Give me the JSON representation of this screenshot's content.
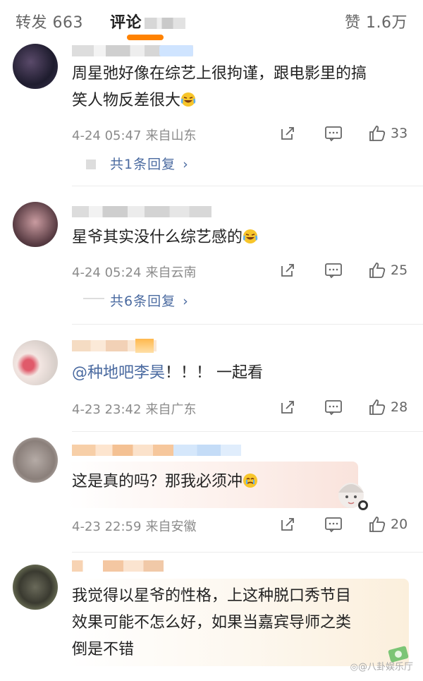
{
  "tabs": {
    "repost_label": "转发 663",
    "comments_label": "评论",
    "likes_label": "赞 1.6万"
  },
  "comments": [
    {
      "content_lines": [
        "周星弛好像在综艺上很拘谨，跟电影里的搞",
        "笑人物反差很大"
      ],
      "time": "4-24 05:47",
      "location": "来自山东",
      "likes": "33",
      "replies": "共1条回复"
    },
    {
      "content_lines": [
        "星爷其实没什么综艺感的"
      ],
      "time": "4-24 05:24",
      "location": "来自云南",
      "likes": "25",
      "replies": "共6条回复"
    },
    {
      "content_mention": "@种地吧李昊",
      "content_rest": "！！！ 一起看",
      "time": "4-23 23:42",
      "location": "来自广东",
      "likes": "28"
    },
    {
      "content_lines": [
        "这是真的吗？那我必须冲"
      ],
      "time": "4-23 22:59",
      "location": "来自安徽",
      "likes": "20"
    },
    {
      "content_lines": [
        "我觉得以星爷的性格，上这种脱口秀节目",
        "效果可能不怎么好，如果当嘉宾导师之类",
        "倒是不错"
      ]
    }
  ],
  "watermark": "八卦娱乐厅",
  "icons": {
    "share": "share-icon",
    "comment": "comment-icon",
    "like": "like-icon"
  },
  "colors": {
    "accent": "#ff8200",
    "link": "#4a6aa0",
    "meta": "#8b8b8b"
  }
}
